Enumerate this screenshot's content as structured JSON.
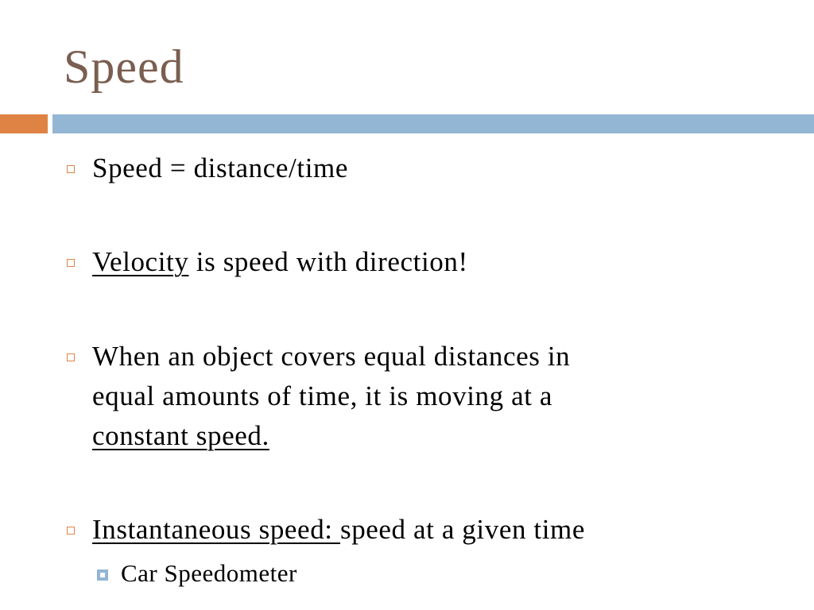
{
  "slide": {
    "title": "Speed",
    "bullets": [
      {
        "pre": "",
        "underlined": "",
        "rest": "Speed = distance/time"
      },
      {
        "pre": "",
        "underlined": "Velocity",
        "rest": " is speed with direction!"
      },
      {
        "line1": "When an object covers equal distances in",
        "line2": "equal amounts of time, it is moving at a",
        "underlined": "constant speed."
      },
      {
        "underlined": "Instantaneous speed: ",
        "rest": "speed at a given time"
      }
    ],
    "sub_bullets": [
      {
        "text": "Car Speedometer"
      }
    ]
  },
  "colors": {
    "title": "#7a5e50",
    "accent_orange": "#de8344",
    "accent_blue": "#93b6d4"
  }
}
